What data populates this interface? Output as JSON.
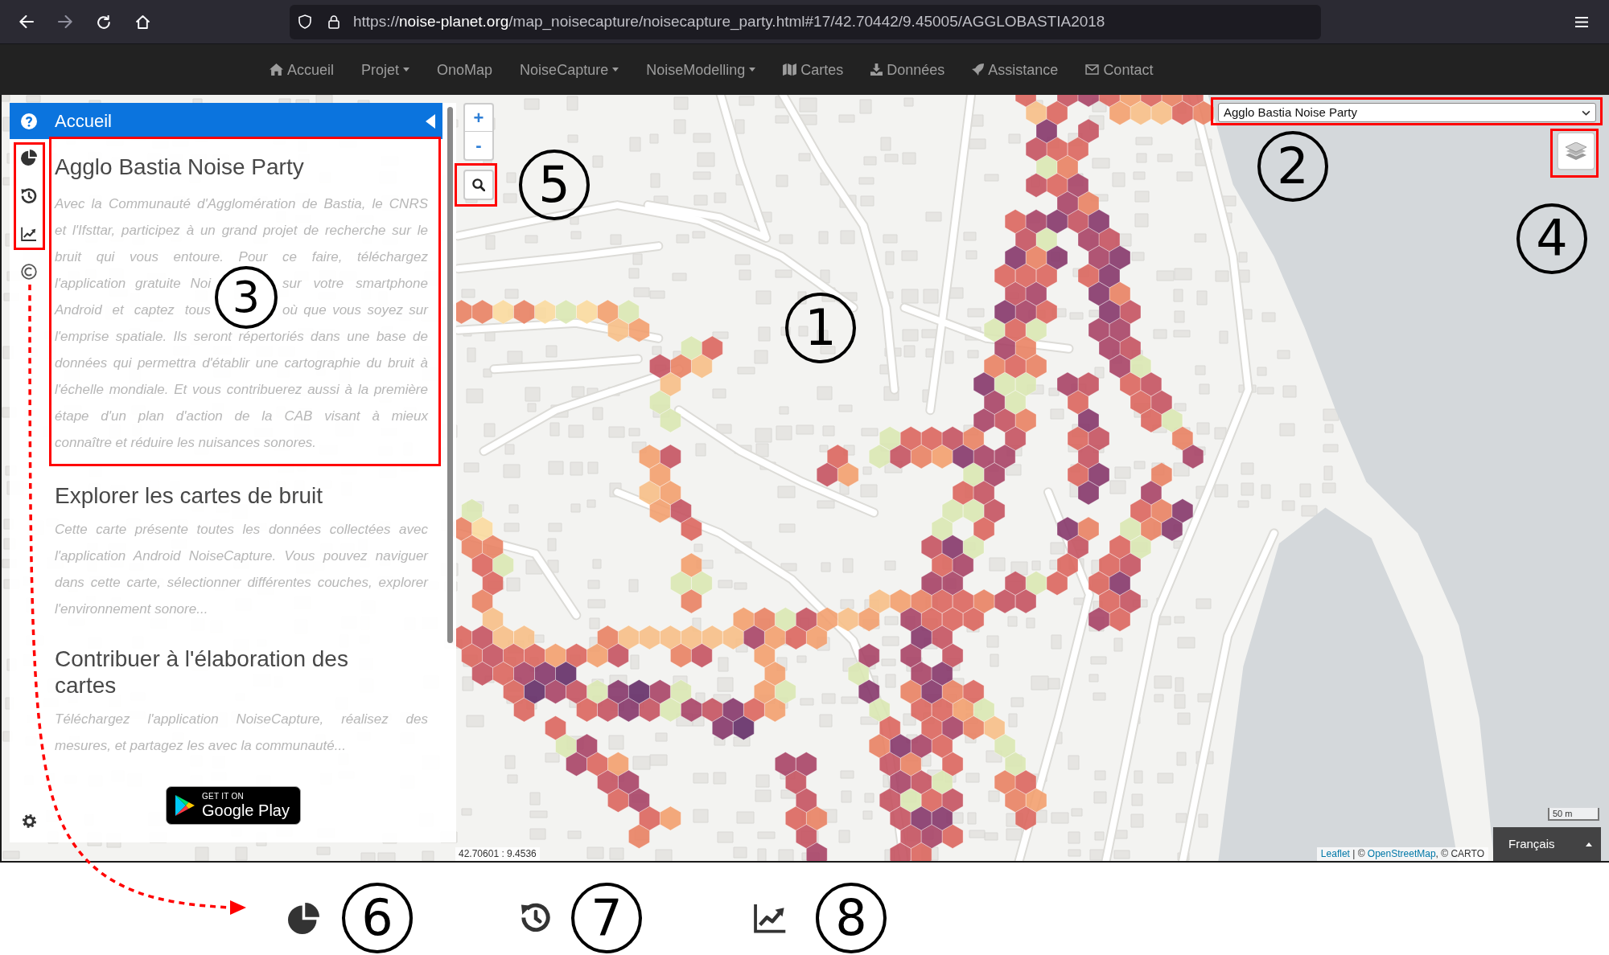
{
  "browser": {
    "buttons": [
      {
        "disabled": false
      },
      {
        "disabled": true
      },
      {
        "disabled": false
      },
      {
        "disabled": false
      }
    ],
    "url": {
      "scheme": "https://",
      "domain": "noise-planet.org",
      "path": "/map_noisecapture/noisecapture_party.html#17/42.70442/9.45005/AGGLOBASTIA2018"
    }
  },
  "navbar": {
    "items": [
      {
        "label": "Accueil",
        "kind": "link"
      },
      {
        "label": "Projet",
        "kind": "dropdown"
      },
      {
        "label": "OnoMap",
        "kind": "link"
      },
      {
        "label": "NoiseCapture",
        "kind": "dropdown"
      },
      {
        "label": "NoiseModelling",
        "kind": "dropdown"
      },
      {
        "label": "Cartes",
        "kind": "link"
      },
      {
        "label": "Données",
        "kind": "link"
      },
      {
        "label": "Assistance",
        "kind": "link"
      },
      {
        "label": "Contact",
        "kind": "link"
      }
    ]
  },
  "sidebar": {
    "header": "Accueil",
    "sections": [
      {
        "kind": "split_lines",
        "title": "Agglo Bastia Noise Party",
        "lines": [
          [
            "Avec la Communauté d'Agglomération de Bastia, le CNRS"
          ],
          [
            "et l'Ifsttar, participez à un grand projet de recherche sur le"
          ],
          [
            "bruit qui vous entoure. Pour ce faire, téléchargez"
          ],
          [
            "l'application gratuite Noi",
            "sur votre smartphone"
          ],
          [
            "Android et captez tous",
            "où que vous soyez sur"
          ],
          [
            "l'emprise spatiale. Ils seront répertoriés dans une base de"
          ],
          [
            "données qui permettra d'établir une cartographie du bruit à"
          ],
          [
            "l'échelle mondiale. Et vous contribuerez aussi à la première"
          ],
          [
            "étape d'un plan d'action de la CAB visant à mieux"
          ],
          [
            "connaître et réduire les nuisances sonores."
          ]
        ]
      },
      {
        "kind": "paragraph",
        "title": "Explorer les cartes de bruit",
        "text": "Cette carte présente toutes les données collectées avec l'application Android NoiseCapture. Vous pouvez naviguer dans cette carte, sélectionner différentes couches, explorer l'environnement sonore..."
      },
      {
        "kind": "paragraph",
        "title": "Contribuer à l'élaboration des cartes",
        "text": "Téléchargez l'application NoiseCapture, réalisez des mesures, et partagez les avec la communauté..."
      }
    ],
    "badge": {
      "small": "GET IT ON",
      "large": "Google Play"
    }
  },
  "map": {
    "zoom_buttons": [
      "+",
      "-"
    ],
    "layer_select": "Agglo Bastia Noise Party",
    "coordinates": "42.70601 : 9.4536",
    "scale": "50 m",
    "attribution": [
      {
        "text": "Leaflet",
        "kind": "link"
      },
      {
        "text": " | © ",
        "kind": "plain"
      },
      {
        "text": "OpenStreetMap",
        "kind": "link"
      },
      {
        "text": ", © CARTO",
        "kind": "plain"
      }
    ],
    "language": "Français"
  },
  "annotations": {
    "callouts": [
      "1",
      "2",
      "3",
      "4",
      "5"
    ],
    "legend": [
      "6",
      "7",
      "8"
    ]
  }
}
